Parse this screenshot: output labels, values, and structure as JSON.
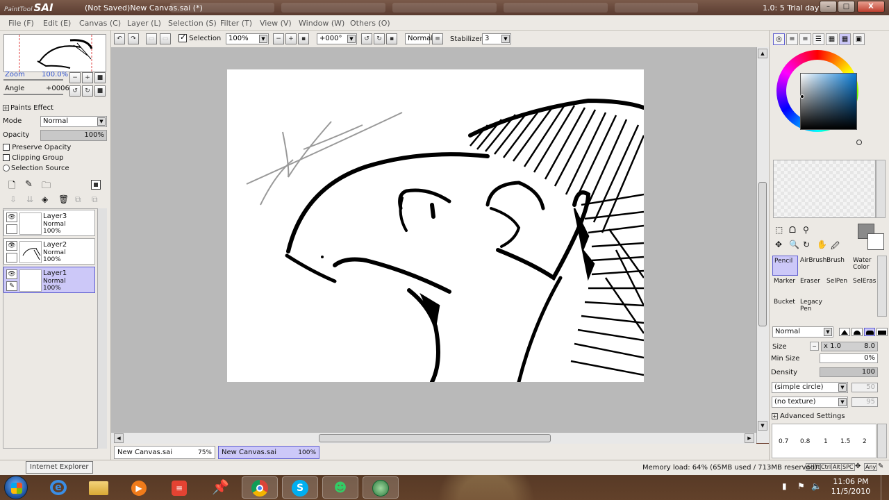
{
  "window": {
    "logo_small": "PaintTool",
    "logo_big": "SAI",
    "title": "(Not Saved)New Canvas.sai (*)",
    "trial": "1.0: 5 Trial day",
    "minimize": "–",
    "maximize": "□",
    "close": "X"
  },
  "menu": [
    "File (F)",
    "Edit (E)",
    "Canvas (C)",
    "Layer (L)",
    "Selection (S)",
    "Filter (T)",
    "View (V)",
    "Window (W)",
    "Others (O)"
  ],
  "toolbar": {
    "selection_label": "Selection",
    "selection_checked": true,
    "zoom_value": "100%",
    "angle_value": "+000°",
    "blend_value": "Normal",
    "stabilizer_label": "Stabilizer",
    "stabilizer_value": "3"
  },
  "navigator": {
    "zoom_label": "Zoom",
    "zoom_value": "100.0%",
    "angle_label": "Angle",
    "angle_value": "+0006"
  },
  "layer_props": {
    "paints_effect": "Paints Effect",
    "mode_label": "Mode",
    "mode_value": "Normal",
    "opacity_label": "Opacity",
    "opacity_value": "100%",
    "preserve_opacity": "Preserve Opacity",
    "clipping_group": "Clipping Group",
    "selection_source": "Selection Source"
  },
  "layers": [
    {
      "name": "Layer3",
      "mode": "Normal",
      "opacity": "100%",
      "selected": false
    },
    {
      "name": "Layer2",
      "mode": "Normal",
      "opacity": "100%",
      "selected": false
    },
    {
      "name": "Layer1",
      "mode": "Normal",
      "opacity": "100%",
      "selected": true
    }
  ],
  "canvas_tabs": [
    {
      "name": "New Canvas.sai",
      "zoom": "75%",
      "active": false
    },
    {
      "name": "New Canvas.sai",
      "zoom": "100%",
      "active": true
    }
  ],
  "tools": [
    {
      "label": "Pencil",
      "selected": true
    },
    {
      "label": "AirBrush",
      "selected": false
    },
    {
      "label": "Brush",
      "selected": false
    },
    {
      "label": "Water Color",
      "selected": false
    },
    {
      "label": "Marker",
      "selected": false
    },
    {
      "label": "Eraser",
      "selected": false
    },
    {
      "label": "SelPen",
      "selected": false
    },
    {
      "label": "SelEras",
      "selected": false
    },
    {
      "label": "Bucket",
      "selected": false
    },
    {
      "label": "Legacy Pen",
      "selected": false
    }
  ],
  "brush": {
    "blend": "Normal",
    "size_label": "Size",
    "size_mult": "x 1.0",
    "size_value": "8.0",
    "min_size_label": "Min Size",
    "min_size_value": "0%",
    "density_label": "Density",
    "density_value": "100",
    "shape": "(simple circle)",
    "shape_value": "50",
    "texture": "(no texture)",
    "texture_value": "95",
    "advanced": "Advanced Settings",
    "presets": [
      "0.7",
      "0.8",
      "1",
      "1.5",
      "2"
    ]
  },
  "status": {
    "memory": "Memory load: 64% (65MB used / 713MB reserved)",
    "keys": [
      "Shift",
      "Ctrl",
      "Alt",
      "SPC",
      "Any"
    ]
  },
  "tooltip": "Internet Explorer",
  "clock": {
    "time": "11:06 PM",
    "date": "11/5/2010"
  },
  "colors": {
    "selection": "#ccc8f8",
    "panel": "#ece9e4",
    "canvas_bg": "#b9b9b9"
  }
}
